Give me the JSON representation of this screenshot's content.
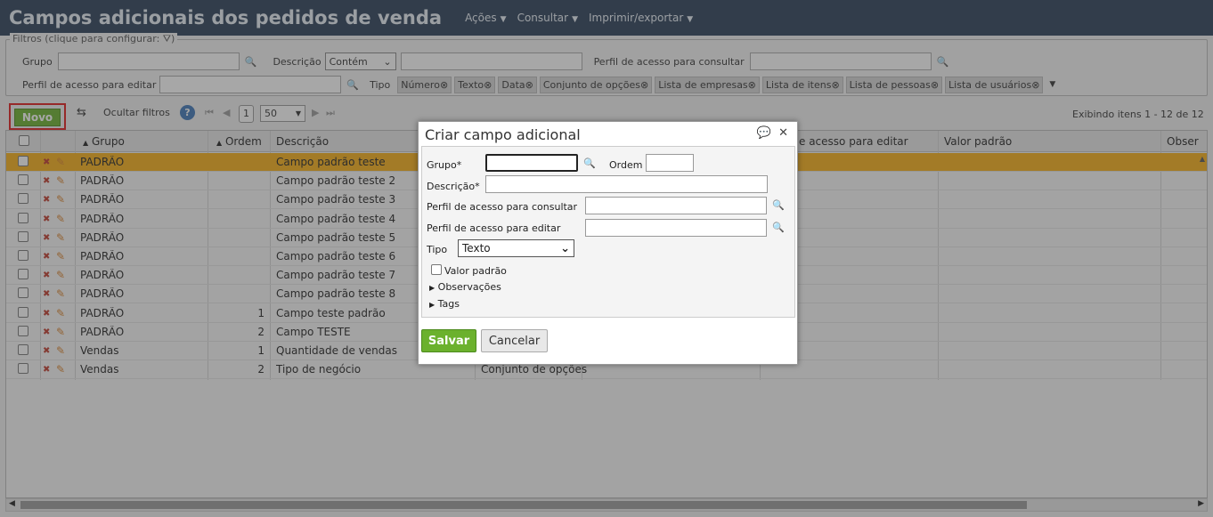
{
  "header": {
    "title": "Campos adicionais dos pedidos de venda",
    "menu": [
      "Ações",
      "Consultar",
      "Imprimir/exportar"
    ]
  },
  "filters": {
    "legend": "Filtros (clique para configurar:",
    "grupo_label": "Grupo",
    "descricao_label": "Descrição",
    "descricao_mode": "Contém",
    "perfil_consultar_label": "Perfil de acesso para consultar",
    "perfil_editar_label": "Perfil de acesso para editar",
    "tipo_label": "Tipo",
    "tipo_chips": [
      "Número",
      "Texto",
      "Data",
      "Conjunto de opções",
      "Lista de empresas",
      "Lista de itens",
      "Lista de pessoas",
      "Lista de usuários"
    ]
  },
  "toolbar": {
    "novo": "Novo",
    "ocultar_filtros": "Ocultar filtros",
    "page": "1",
    "page_size": "50",
    "summary": "Exibindo itens 1 - 12 de 12"
  },
  "grid": {
    "headers": {
      "grupo": "Grupo",
      "ordem": "Ordem",
      "descricao": "Descrição",
      "perfil_editar": "e acesso para editar",
      "valor_padrao": "Valor padrão",
      "observacoes": "Obser"
    },
    "rows": [
      {
        "grupo": "PADRÃO",
        "ordem": "",
        "descricao": "Campo padrão teste",
        "tipo": ""
      },
      {
        "grupo": "PADRÃO",
        "ordem": "",
        "descricao": "Campo padrão teste 2",
        "tipo": ""
      },
      {
        "grupo": "PADRÃO",
        "ordem": "",
        "descricao": "Campo padrão teste 3",
        "tipo": ""
      },
      {
        "grupo": "PADRÃO",
        "ordem": "",
        "descricao": "Campo padrão teste 4",
        "tipo": ""
      },
      {
        "grupo": "PADRÃO",
        "ordem": "",
        "descricao": "Campo padrão teste 5",
        "tipo": ""
      },
      {
        "grupo": "PADRÃO",
        "ordem": "",
        "descricao": "Campo padrão teste 6",
        "tipo": ""
      },
      {
        "grupo": "PADRÃO",
        "ordem": "",
        "descricao": "Campo padrão teste 7",
        "tipo": ""
      },
      {
        "grupo": "PADRÃO",
        "ordem": "",
        "descricao": "Campo padrão teste 8",
        "tipo": ""
      },
      {
        "grupo": "PADRÃO",
        "ordem": "1",
        "descricao": "Campo teste padrão",
        "tipo": ""
      },
      {
        "grupo": "PADRÃO",
        "ordem": "2",
        "descricao": "Campo TESTE",
        "tipo": ""
      },
      {
        "grupo": "Vendas",
        "ordem": "1",
        "descricao": "Quantidade de vendas",
        "tipo": ""
      },
      {
        "grupo": "Vendas",
        "ordem": "2",
        "descricao": "Tipo de negócio",
        "tipo": "Conjunto de opções"
      }
    ]
  },
  "dialog": {
    "title": "Criar campo adicional",
    "grupo_label": "Grupo*",
    "ordem_label": "Ordem",
    "descricao_label": "Descrição*",
    "perfil_consultar_label": "Perfil de acesso para consultar",
    "perfil_editar_label": "Perfil de acesso para editar",
    "tipo_label": "Tipo",
    "tipo_value": "Texto",
    "valor_padrao_label": "Valor padrão",
    "observacoes_label": "Observações",
    "tags_label": "Tags",
    "salvar": "Salvar",
    "cancelar": "Cancelar"
  }
}
